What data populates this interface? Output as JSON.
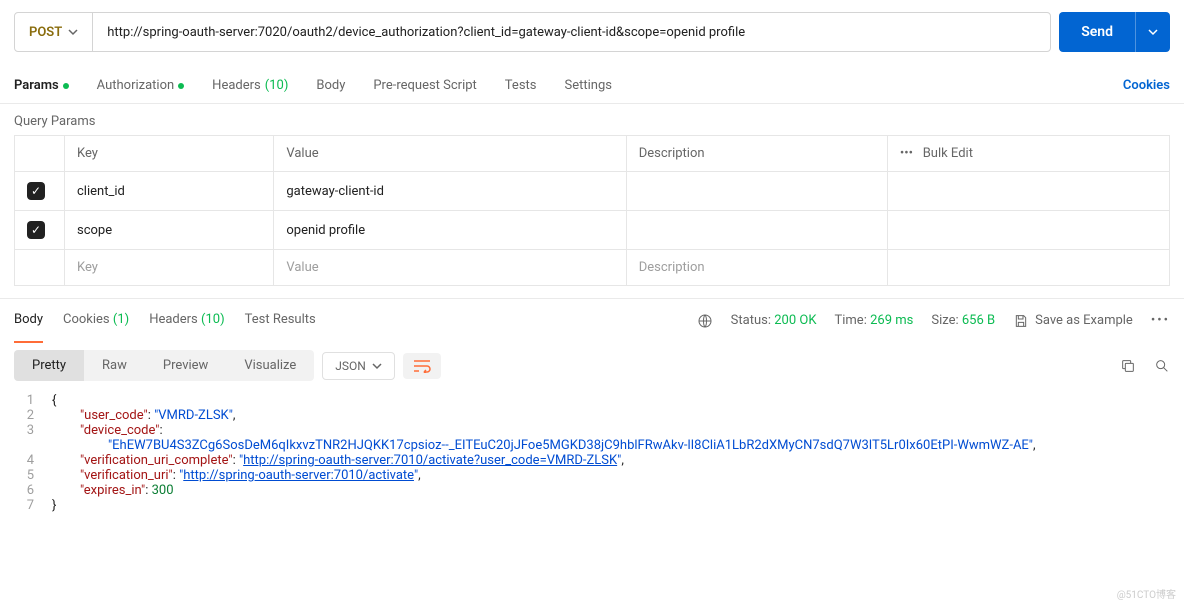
{
  "request": {
    "method": "POST",
    "url": "http://spring-oauth-server:7020/oauth2/device_authorization?client_id=gateway-client-id&scope=openid profile",
    "send_label": "Send"
  },
  "tabs": {
    "params": "Params",
    "authorization": "Authorization",
    "headers": "Headers",
    "headers_count": "(10)",
    "body": "Body",
    "prerequest": "Pre-request Script",
    "tests": "Tests",
    "settings": "Settings",
    "cookies": "Cookies"
  },
  "query": {
    "title": "Query Params",
    "th_key": "Key",
    "th_value": "Value",
    "th_desc": "Description",
    "bulk_edit": "Bulk Edit",
    "rows": [
      {
        "key": "client_id",
        "value": "gateway-client-id"
      },
      {
        "key": "scope",
        "value": "openid profile"
      }
    ],
    "ph_key": "Key",
    "ph_value": "Value",
    "ph_desc": "Description"
  },
  "response": {
    "tab_body": "Body",
    "tab_cookies": "Cookies",
    "cookies_count": "(1)",
    "tab_headers": "Headers",
    "headers_count": "(10)",
    "tab_tests": "Test Results",
    "status_label": "Status:",
    "status_value": "200 OK",
    "time_label": "Time:",
    "time_value": "269 ms",
    "size_label": "Size:",
    "size_value": "656 B",
    "save_example": "Save as Example"
  },
  "viewer": {
    "pretty": "Pretty",
    "raw": "Raw",
    "preview": "Preview",
    "visualize": "Visualize",
    "format": "JSON"
  },
  "body": {
    "l1": "{",
    "user_code_k": "\"user_code\"",
    "user_code_v": "\"VMRD-ZLSK\"",
    "device_code_k": "\"device_code\"",
    "device_code_v": "\"EhEW7BU4S3ZCg6SosDeM6qIkxvzTNR2HJQKK17cpsioz--_EITEuC20jJFoe5MGKD38jC9hblFRwAkv-lI8CliA1LbR2dXMyCN7sdQ7W3lT5Lr0Ix60EtPI-WwmWZ-AE\"",
    "vuc_k": "\"verification_uri_complete\"",
    "vuc_v": "\"http://spring-oauth-server:7010/activate?user_code=VMRD-ZLSK\"",
    "vu_k": "\"verification_uri\"",
    "vu_v": "\"http://spring-oauth-server:7010/activate\"",
    "exp_k": "\"expires_in\"",
    "exp_v": "300",
    "l7": "}"
  },
  "watermark": "@51CTO博客"
}
